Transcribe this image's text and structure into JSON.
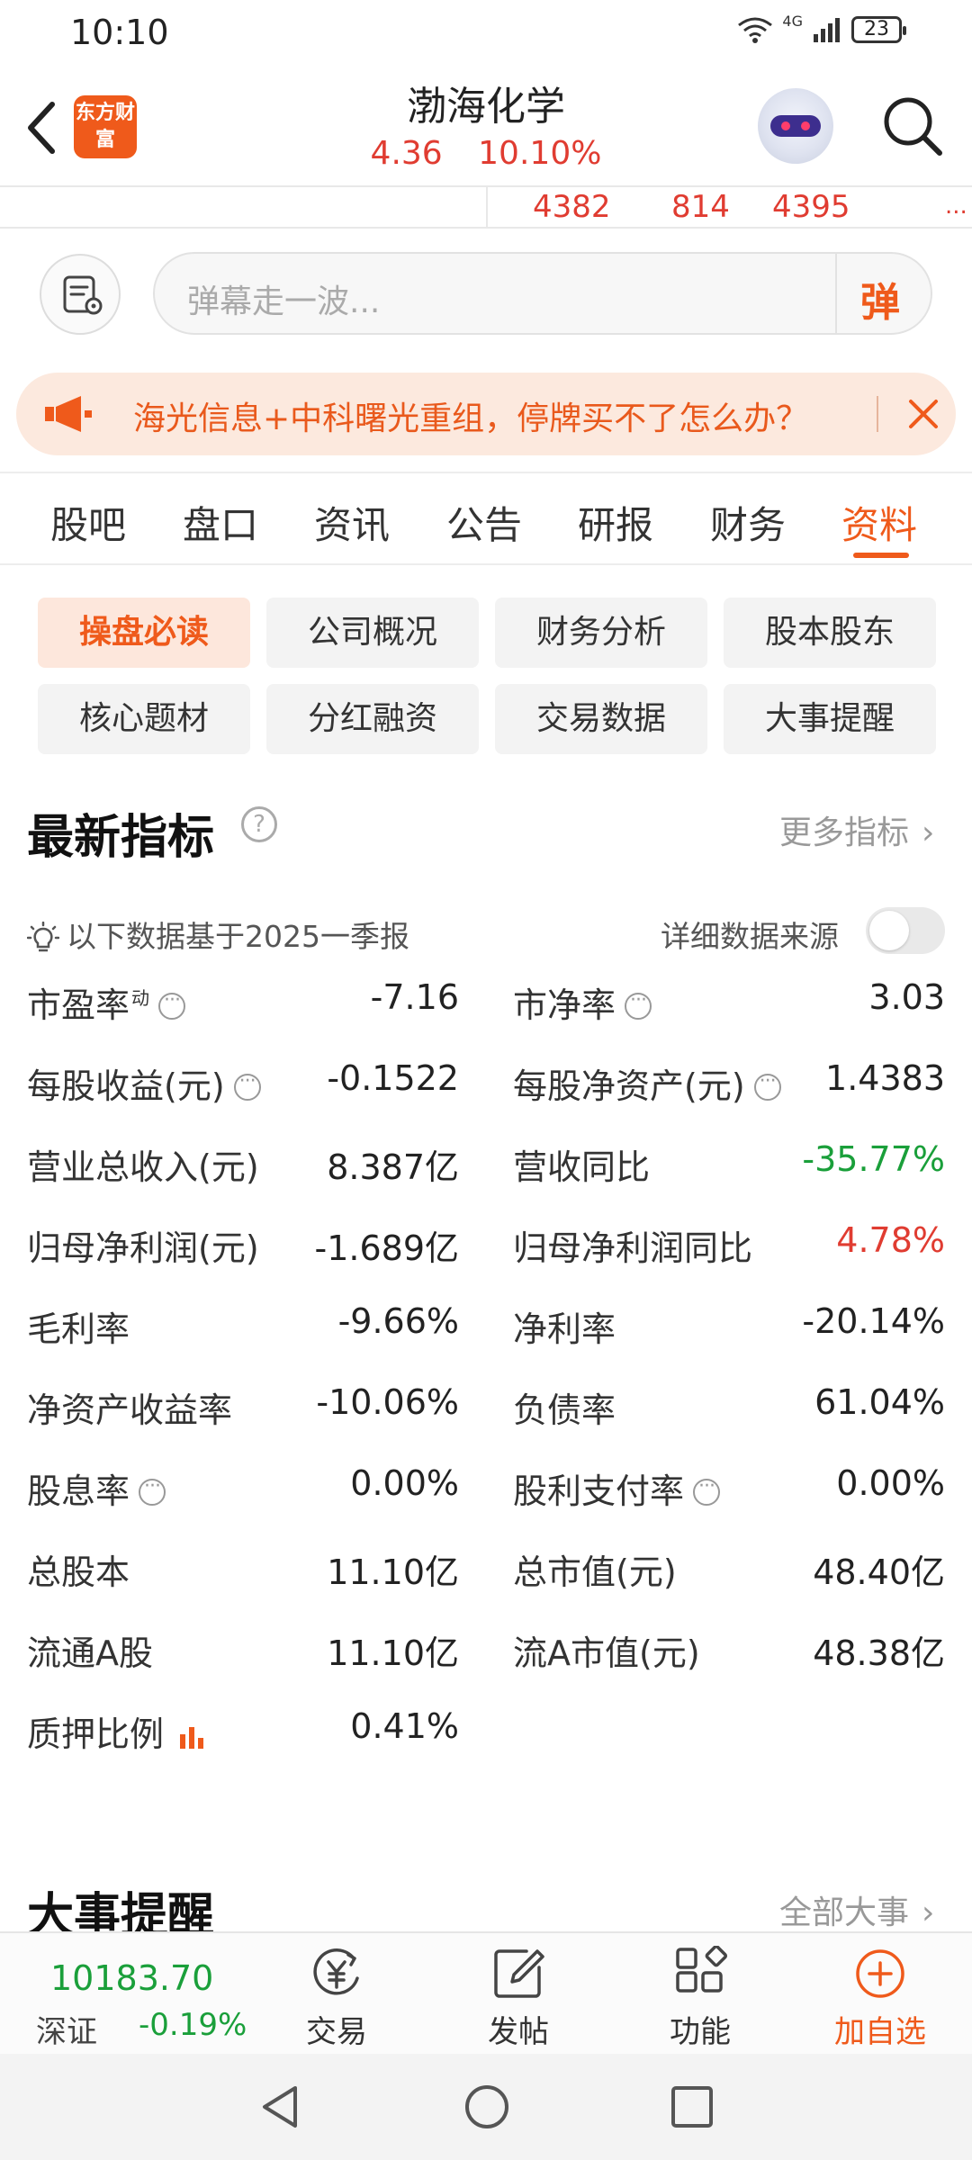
{
  "status": {
    "time": "10:10",
    "network": "4G",
    "battery": "23"
  },
  "header": {
    "logo_text": "东方财富",
    "stock_name": "渤海化学",
    "price": "4.36",
    "change_pct": "10.10%"
  },
  "ticker": {
    "v1": "4382",
    "v2": "814",
    "v3": "4395",
    "more": "..."
  },
  "danmu": {
    "placeholder": "弹幕走一波...",
    "button": "弹"
  },
  "notice": {
    "text": "海光信息+中科曙光重组，停牌买不了怎么办？"
  },
  "tabs": [
    "股吧",
    "盘口",
    "资讯",
    "公告",
    "研报",
    "财务",
    "资料"
  ],
  "active_tab": "资料",
  "chips": [
    "操盘必读",
    "公司概况",
    "财务分析",
    "股本股东",
    "核心题材",
    "分红融资",
    "交易数据",
    "大事提醒"
  ],
  "section1": {
    "title": "最新指标",
    "more": "更多指标"
  },
  "note": {
    "text": "以下数据基于2025一季报",
    "source": "详细数据来源"
  },
  "metrics": {
    "pe_label": "市盈率",
    "pe_sup": "动",
    "pe": "-7.16",
    "pb_label": "市净率",
    "pb": "3.03",
    "eps_label": "每股收益(元)",
    "eps": "-0.1522",
    "bvps_label": "每股净资产(元)",
    "bvps": "1.4383",
    "rev_label": "营业总收入(元)",
    "rev": "8.387亿",
    "revyoy_label": "营收同比",
    "revyoy": "-35.77%",
    "np_label": "归母净利润(元)",
    "np": "-1.689亿",
    "npyoy_label": "归母净利润同比",
    "npyoy": "4.78%",
    "gm_label": "毛利率",
    "gm": "-9.66%",
    "nm_label": "净利率",
    "nm": "-20.14%",
    "roe_label": "净资产收益率",
    "roe": "-10.06%",
    "debt_label": "负债率",
    "debt": "61.04%",
    "dy_label": "股息率",
    "dy": "0.00%",
    "payout_label": "股利支付率",
    "payout": "0.00%",
    "shares_label": "总股本",
    "shares": "11.10亿",
    "mcap_label": "总市值(元)",
    "mcap": "48.40亿",
    "float_label": "流通A股",
    "float": "11.10亿",
    "fmcap_label": "流A市值(元)",
    "fmcap": "48.38亿",
    "pledge_label": "质押比例",
    "pledge": "0.41%"
  },
  "section2": {
    "title": "大事提醒",
    "more": "全部大事"
  },
  "bottom": {
    "index_value": "10183.70",
    "index_name": "深证",
    "index_change": "-0.19%",
    "nav": [
      "交易",
      "发帖",
      "功能",
      "加自选"
    ]
  },
  "colors": {
    "accent": "#ef5a1b",
    "up": "#e03c31",
    "down": "#1a9f3a"
  }
}
